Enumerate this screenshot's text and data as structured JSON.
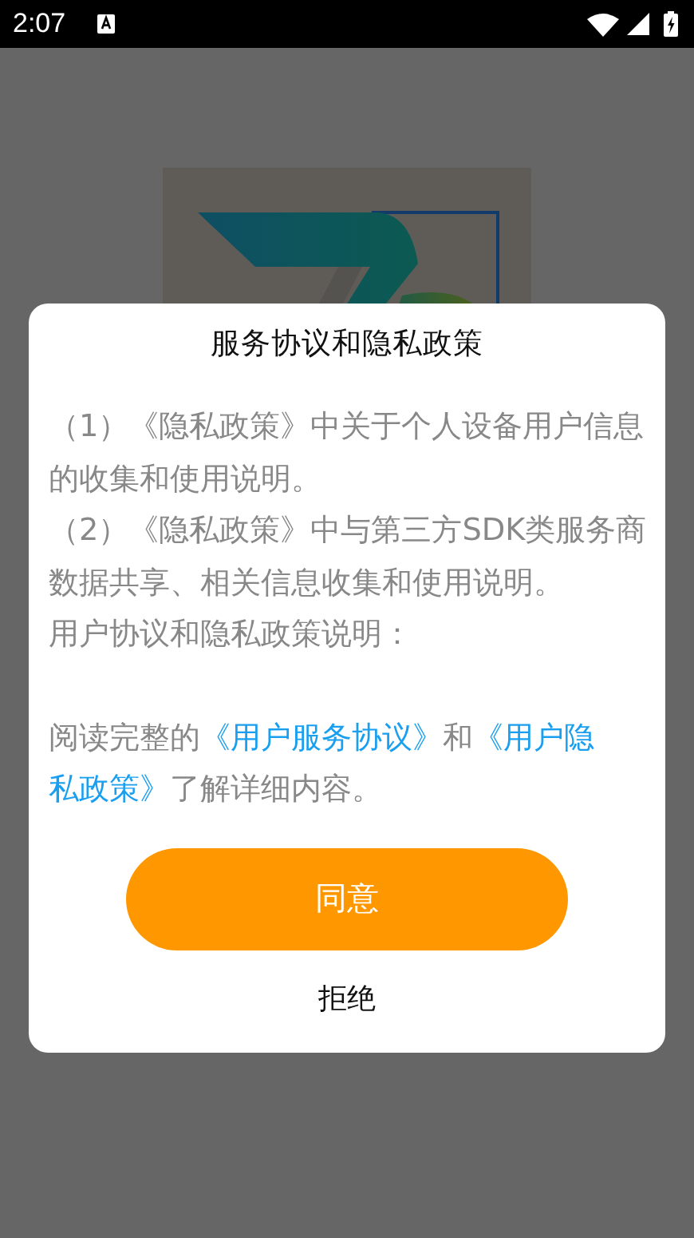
{
  "status_bar": {
    "time": "2:07"
  },
  "dialog": {
    "title": "服务协议和隐私政策",
    "paragraphs": [
      "（1）《隐私政策》中关于个人设备用户信息的收集和使用说明。",
      "（2）《隐私政策》中与第三方SDK类服务商数据共享、相关信息收集和使用说明。",
      "用户协议和隐私政策说明："
    ],
    "notice": [
      {
        "kind": "text",
        "text": "阅读完整的"
      },
      {
        "kind": "link",
        "text": "《用户服务协议》"
      },
      {
        "kind": "text",
        "text": "和"
      },
      {
        "kind": "link",
        "text": "《用户隐"
      },
      {
        "kind": "link",
        "text": "私政策》"
      },
      {
        "kind": "text",
        "text": "了解详细内容。"
      }
    ],
    "agree_button": "同意",
    "decline_button": "拒绝"
  }
}
